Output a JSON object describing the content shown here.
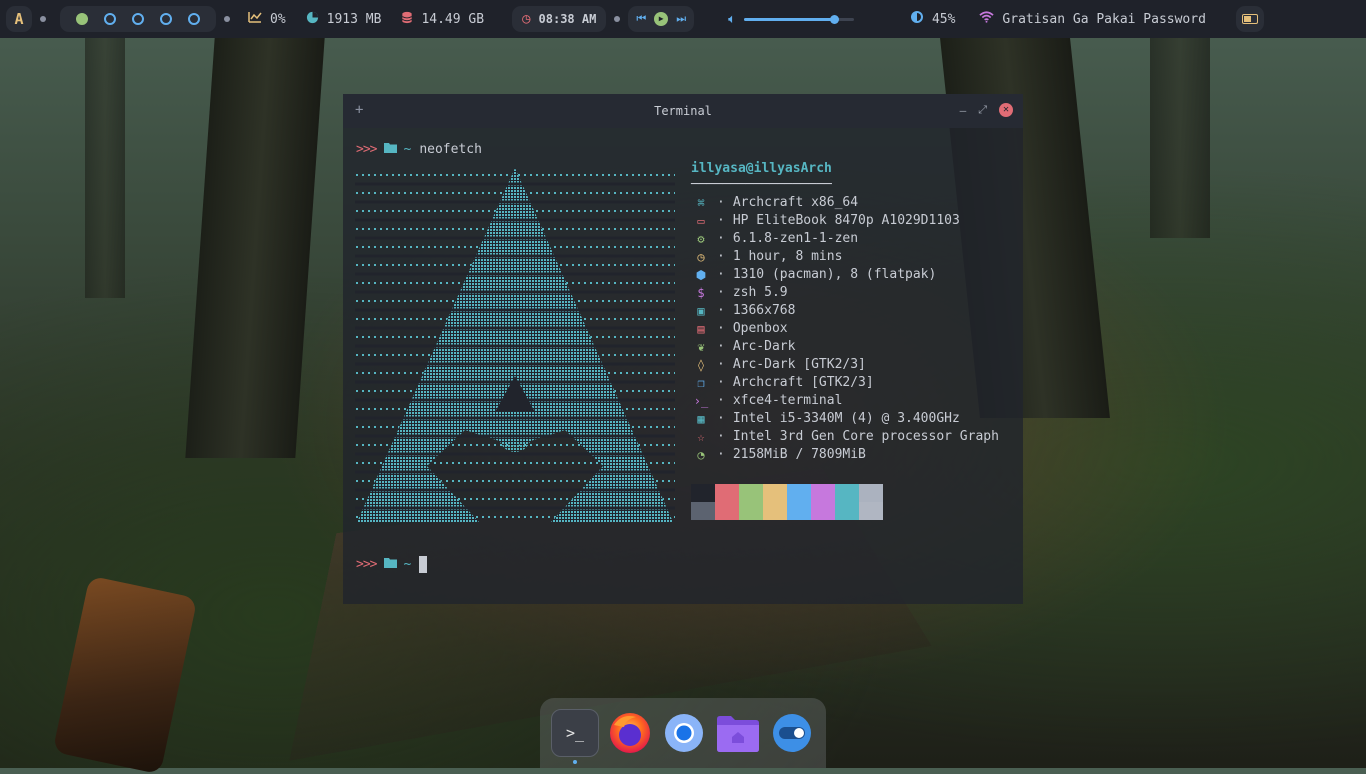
{
  "topbar": {
    "launcher_glyph": "A",
    "cpu": "0%",
    "memory": "1913 MB",
    "disk": "14.49 GB",
    "clock": "08:38 AM",
    "volume_level": 0.82,
    "brightness": "45%",
    "wifi_ssid": "Gratisan Ga Pakai Password",
    "workspaces": [
      {
        "active": true
      },
      {
        "active": false
      },
      {
        "active": false
      },
      {
        "active": false
      },
      {
        "active": false
      }
    ],
    "colors": {
      "accent": "#61afef",
      "active_ws": "#98c379",
      "battery": "#e5c07b"
    }
  },
  "terminal": {
    "title": "Terminal",
    "add_glyph": "+",
    "minimize_glyph": "–",
    "maximize_glyph": "⤢",
    "close_glyph": "✕",
    "prompt_arrows": ">>>",
    "prompt_dir": "~",
    "command": "neofetch",
    "user_host": "illyasa@illyasArch",
    "rule": "──────────────────",
    "info": [
      {
        "icon": "command-icon",
        "glyph": "⌘",
        "color": "#56b6c2",
        "text": "Archcraft x86_64"
      },
      {
        "icon": "monitor-icon",
        "glyph": "▭",
        "color": "#e06c75",
        "text": "HP EliteBook 8470p A1029D1103"
      },
      {
        "icon": "gear-icon",
        "glyph": "⚙",
        "color": "#98c379",
        "text": "6.1.8-zen1-1-zen"
      },
      {
        "icon": "clock-icon",
        "glyph": "◷",
        "color": "#e5c07b",
        "text": "1 hour, 8 mins"
      },
      {
        "icon": "package-icon",
        "glyph": "⬢",
        "color": "#61afef",
        "text": "1310 (pacman), 8 (flatpak)"
      },
      {
        "icon": "dollar-icon",
        "glyph": "$",
        "color": "#c678dd",
        "text": "zsh 5.9"
      },
      {
        "icon": "image-icon",
        "glyph": "▣",
        "color": "#56b6c2",
        "text": "1366x768"
      },
      {
        "icon": "window-icon",
        "glyph": "▤",
        "color": "#e06c75",
        "text": "Openbox"
      },
      {
        "icon": "leaf-icon",
        "glyph": "❦",
        "color": "#98c379",
        "text": "Arc-Dark"
      },
      {
        "icon": "droplet-icon",
        "glyph": "◊",
        "color": "#e5c07b",
        "text": "Arc-Dark [GTK2/3]"
      },
      {
        "icon": "copy-icon",
        "glyph": "❐",
        "color": "#61afef",
        "text": "Archcraft [GTK2/3]"
      },
      {
        "icon": "terminal-icon",
        "glyph": "›_",
        "color": "#c678dd",
        "text": "xfce4-terminal"
      },
      {
        "icon": "cpu-icon",
        "glyph": "▦",
        "color": "#56b6c2",
        "text": "Intel i5-3340M (4) @ 3.400GHz"
      },
      {
        "icon": "star-icon",
        "glyph": "☆",
        "color": "#e06c75",
        "text": "Intel 3rd Gen Core processor Graph"
      },
      {
        "icon": "pie-icon",
        "glyph": "◔",
        "color": "#98c379",
        "text": "2158MiB / 7809MiB"
      }
    ],
    "info_separator": "·",
    "palette_top": [
      "#21242c",
      "#e06c75",
      "#98c379",
      "#e5c07b",
      "#61afef",
      "#c678dd",
      "#56b6c2",
      "#abb2bf"
    ],
    "palette_bottom": [
      "#5c6370",
      "#e06c75",
      "#98c379",
      "#e5c07b",
      "#61afef",
      "#c678dd",
      "#56b6c2",
      "#b0b6c2"
    ],
    "art_color": "#56b6c2"
  },
  "dock": {
    "apps": [
      {
        "name": "terminal",
        "glyph": ">_",
        "running": true
      },
      {
        "name": "firefox",
        "glyph": "",
        "running": false
      },
      {
        "name": "chromium",
        "glyph": "",
        "running": false
      },
      {
        "name": "files",
        "glyph": "",
        "running": false
      },
      {
        "name": "toggle",
        "glyph": "",
        "running": false
      }
    ]
  }
}
